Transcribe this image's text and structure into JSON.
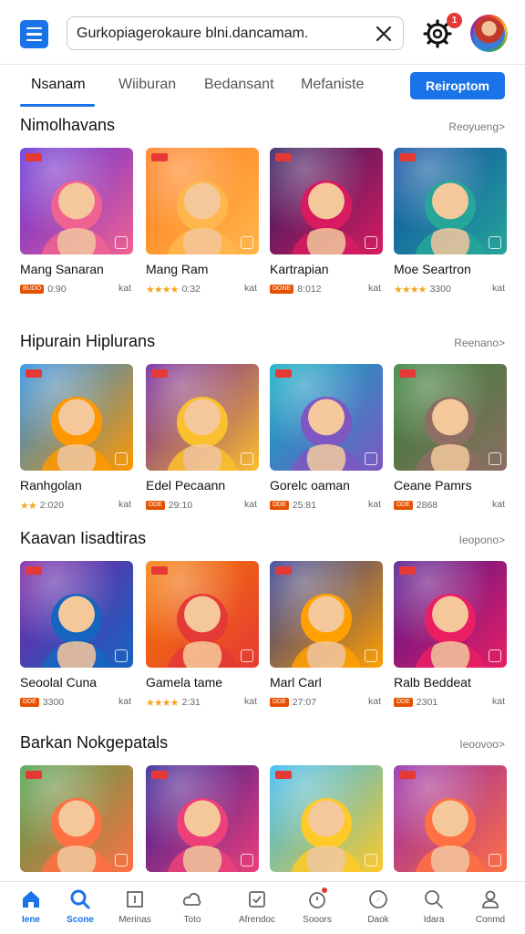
{
  "header": {
    "search_value": "Gurkopiagerokaure blni.dancamam.",
    "notification_count": "1"
  },
  "tabs": [
    {
      "label": "Nsanam",
      "active": true
    },
    {
      "label": "Wiiburan",
      "active": false
    },
    {
      "label": "Bedansant",
      "active": false
    },
    {
      "label": "Mefaniste",
      "active": false
    }
  ],
  "tab_cta": "Reiroptom",
  "sections": [
    {
      "title": "Nimolhavans",
      "more": "Reoyueng>",
      "cards": [
        {
          "title": "Mang Sanaran",
          "rating": "",
          "badge": "BUDO",
          "count": "0:90",
          "price": "kat",
          "colors": [
            "#5b2bd8",
            "#f06292"
          ]
        },
        {
          "title": "Mang Ram",
          "rating": "★★★★",
          "badge": "",
          "count": "0:32",
          "price": "kat",
          "colors": [
            "#ff7a1a",
            "#ffb74d"
          ]
        },
        {
          "title": "Kartrapian",
          "rating": "",
          "badge": "DONE",
          "count": "8:012",
          "price": "kat",
          "colors": [
            "#2a1a5e",
            "#d81b60"
          ]
        },
        {
          "title": "Moe Seartron",
          "rating": "★★★★",
          "badge": "",
          "count": "3300",
          "price": "kat",
          "colors": [
            "#0d47a1",
            "#26a69a"
          ]
        }
      ]
    },
    {
      "title": "Hipurain Hiplurans",
      "more": "Reenano>",
      "cards": [
        {
          "title": "Ranhgolan",
          "rating": "★★",
          "badge": "",
          "count": "2:020",
          "price": "kat",
          "colors": [
            "#1e88e5",
            "#ff9800"
          ]
        },
        {
          "title": "Edel Pecaann",
          "rating": "",
          "badge": "DDE",
          "count": "29:10",
          "price": "kat",
          "colors": [
            "#6a1b9a",
            "#fbc02d"
          ]
        },
        {
          "title": "Gorelc oaman",
          "rating": "",
          "badge": "DDE",
          "count": "25:81",
          "price": "kat",
          "colors": [
            "#00acc1",
            "#7e57c2"
          ]
        },
        {
          "title": "Ceane Pamrs",
          "rating": "",
          "badge": "DDE",
          "count": "2868",
          "price": "kat",
          "colors": [
            "#2e7d32",
            "#8d6e63"
          ]
        }
      ]
    },
    {
      "title": "Kaavan Iisadtiras",
      "more": "Ieopono>",
      "cards": [
        {
          "title": "Seoolal Cuna",
          "rating": "",
          "badge": "DDE",
          "count": "3300",
          "price": "kat",
          "colors": [
            "#7b1fa2",
            "#1565c0"
          ]
        },
        {
          "title": "Gamela tame",
          "rating": "★★★★",
          "badge": "",
          "count": "2:31",
          "price": "kat",
          "colors": [
            "#f57c00",
            "#e53935"
          ]
        },
        {
          "title": "Marl Carl",
          "rating": "",
          "badge": "DDE",
          "count": "27:07",
          "price": "kat",
          "colors": [
            "#283593",
            "#ffa000"
          ]
        },
        {
          "title": "Ralb Beddeat",
          "rating": "",
          "badge": "DDE",
          "count": "2301",
          "price": "kat",
          "colors": [
            "#4a148c",
            "#e91e63"
          ]
        }
      ]
    },
    {
      "title": "Barkan Nokgepatals",
      "more": "Ieoovoo>",
      "cards": [
        {
          "title": "",
          "rating": "",
          "badge": "",
          "count": "",
          "price": "",
          "colors": [
            "#43a047",
            "#ff7043"
          ]
        },
        {
          "title": "",
          "rating": "",
          "badge": "",
          "count": "",
          "price": "",
          "colors": [
            "#311b92",
            "#ec407a"
          ]
        },
        {
          "title": "",
          "rating": "",
          "badge": "",
          "count": "",
          "price": "",
          "colors": [
            "#29b6f6",
            "#ffca28"
          ]
        },
        {
          "title": "",
          "rating": "",
          "badge": "",
          "count": "",
          "price": "",
          "colors": [
            "#8e24aa",
            "#ff7043"
          ]
        }
      ]
    }
  ],
  "bottom_nav": [
    {
      "label": "Iene",
      "icon": "home-icon",
      "active": true
    },
    {
      "label": "Scone",
      "icon": "search-icon",
      "active": true
    },
    {
      "label": "Merinas",
      "icon": "library-icon",
      "active": false
    },
    {
      "label": "Toto",
      "icon": "cloud-icon",
      "active": false
    },
    {
      "label": "Afrendoc",
      "icon": "checkbox-icon",
      "active": false
    },
    {
      "label": "Sooors",
      "icon": "scores-icon",
      "active": false
    },
    {
      "label": "Daok",
      "icon": "compass-icon",
      "active": false
    },
    {
      "label": "Idara",
      "icon": "magnify-icon",
      "active": false
    },
    {
      "label": "Conmd",
      "icon": "profile-icon",
      "active": false
    }
  ],
  "colors": {
    "accent": "#1a73e8",
    "badge": "#e53935"
  }
}
